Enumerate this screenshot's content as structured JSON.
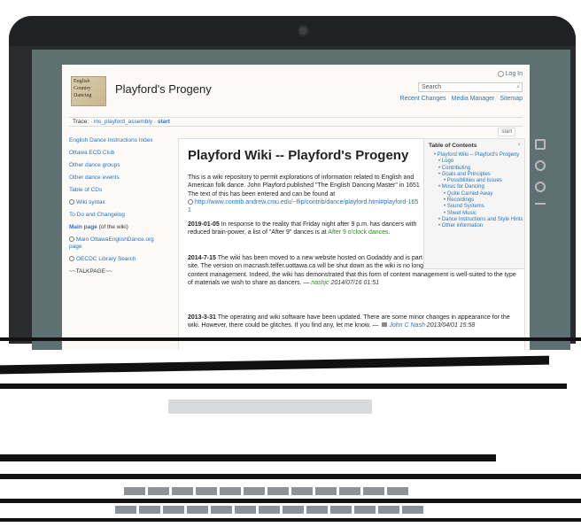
{
  "header": {
    "site_title": "Playford's Progeny",
    "login": "Log In",
    "search_placeholder": "Search",
    "links": [
      "Recent Changes",
      "Media Manager",
      "Sitemap"
    ]
  },
  "logo": {
    "lines": [
      "English",
      "Country",
      "Dancing"
    ]
  },
  "breadcrumb": {
    "label": "Trace:",
    "items": [
      "ins_playford_assembly",
      "start"
    ]
  },
  "start_tab": "start",
  "sidebar": {
    "items": [
      "English Dance Instructions Index",
      "Ottawa ECD Club",
      "Other dance groups",
      "Other dance events",
      "Table of CDs",
      "Wiki syntax",
      "To Do and Changelog",
      "Main page",
      "(of the wiki)",
      "Main OttawaEnglishDance.org page",
      "OECDC Library Search",
      "~~TALKPAGE~~"
    ]
  },
  "content": {
    "title": "Playford Wiki -- Playford's Progeny",
    "intro": "This is a wiki repository to permit explorations of information related to English and American folk dance. John Playford published \"The English Dancing Master\" in 1651 The text of this has been entered and can be found at",
    "intro_link": "http://www.contrib.andrew.cmu.edu/~flip/contrib/dance/playford.html#playford-1651",
    "news1_date": "2019-01-05",
    "news1_text": "In response to the reality that Friday night after 9 p.m. has dancers with reduced brain-power, a list of \"After 9\" dances is at",
    "news1_link": "After 9 o'clock dances",
    "news2_date": "2014-7-15",
    "news2_text": "The wiki has been moved to a new website hosted on Godaddy and is part of the OttawaEnglishDance.org site. The version on macnash.telfer.uottawa.ca will be shut down as the wiki is no longer an investigation into multimedia content management. Indeed, the wiki has demonstrated that this form of content management is well-suited to the type of materials we wish to share as dancers. —",
    "news2_sig": "nashjc",
    "news2_stamp": "2014/07/16 01:51",
    "news3_date": "2013-3-31",
    "news3_text": "The operating and wiki software have been updated. There are some minor changes in appearance for the wiki. However, there could be glitches. If you find any, let me know. —",
    "news3_sig": "John C Nash",
    "news3_stamp": "2013/04/01 15:58"
  },
  "toc": {
    "title": "Table of Contents",
    "close": "×",
    "items": [
      {
        "label": "Playford Wiki -- Playford's Progeny",
        "level": 1
      },
      {
        "label": "Logo",
        "level": 2
      },
      {
        "label": "Contributing",
        "level": 2
      },
      {
        "label": "Goals and Principles",
        "level": 2
      },
      {
        "label": "Possibilities and Issues",
        "level": 3
      },
      {
        "label": "Music for Dancing",
        "level": 2
      },
      {
        "label": "Quite Carried Away",
        "level": 3
      },
      {
        "label": "Recordings",
        "level": 3
      },
      {
        "label": "Sound Systems",
        "level": 3
      },
      {
        "label": "Sheet Music",
        "level": 3
      },
      {
        "label": "Dance Instructions and Style Hints",
        "level": 2
      },
      {
        "label": "Other information",
        "level": 2
      }
    ]
  },
  "page_tools": [
    "show-pagesource-icon",
    "old-revisions-icon",
    "backlinks-icon",
    "back-to-top-icon"
  ],
  "colors": {
    "link": "#2b73b7",
    "green": "#2e8b1e",
    "bezel": "#2a2c30",
    "screen_bg": "#5f7073"
  }
}
